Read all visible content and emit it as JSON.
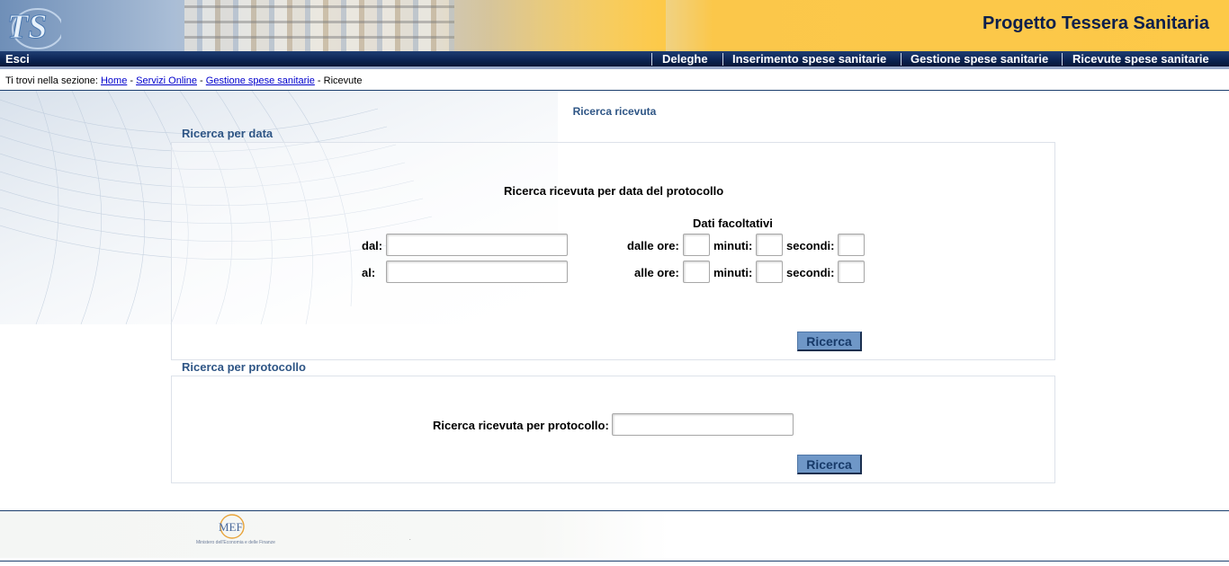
{
  "header": {
    "app_title": "Progetto Tessera Sanitaria",
    "logo_text": "TS",
    "colors": {
      "gold": "#fdc948",
      "navy": "#0b2251",
      "title": "#0b1f4c"
    }
  },
  "navbar": {
    "exit_label": "Esci",
    "items": [
      {
        "label": "Deleghe"
      },
      {
        "label": "Inserimento spese sanitarie"
      },
      {
        "label": "Gestione spese sanitarie"
      },
      {
        "label": "Ricevute spese sanitarie"
      }
    ]
  },
  "breadcrumb": {
    "prefix": "Ti trovi nella sezione:",
    "links": [
      "Home",
      "Servizi Online",
      "Gestione spese sanitarie"
    ],
    "separator": "-",
    "current": "Ricevute"
  },
  "page": {
    "heading": "Ricerca ricevuta",
    "accent_color": "#2e5585"
  },
  "date_search": {
    "section_title": "Ricerca per data",
    "form_title": "Ricerca ricevuta per data del protocollo",
    "optional_title": "Dati facoltativi",
    "from_label": "dal:",
    "to_label": "al:",
    "from_value": "",
    "to_value": "",
    "from_hour_label": "dalle ore:",
    "to_hour_label": "alle ore:",
    "minutes_label": "minuti:",
    "seconds_label": "secondi:",
    "button_label": "Ricerca"
  },
  "protocol_search": {
    "section_title": "Ricerca per protocollo",
    "field_label": "Ricerca ricevuta per protocollo:",
    "field_value": "",
    "button_label": "Ricerca"
  },
  "footer": {
    "logo_text": "MEF",
    "caption": "Ministero dell'Economia e delle Finanze",
    "dot": "."
  }
}
